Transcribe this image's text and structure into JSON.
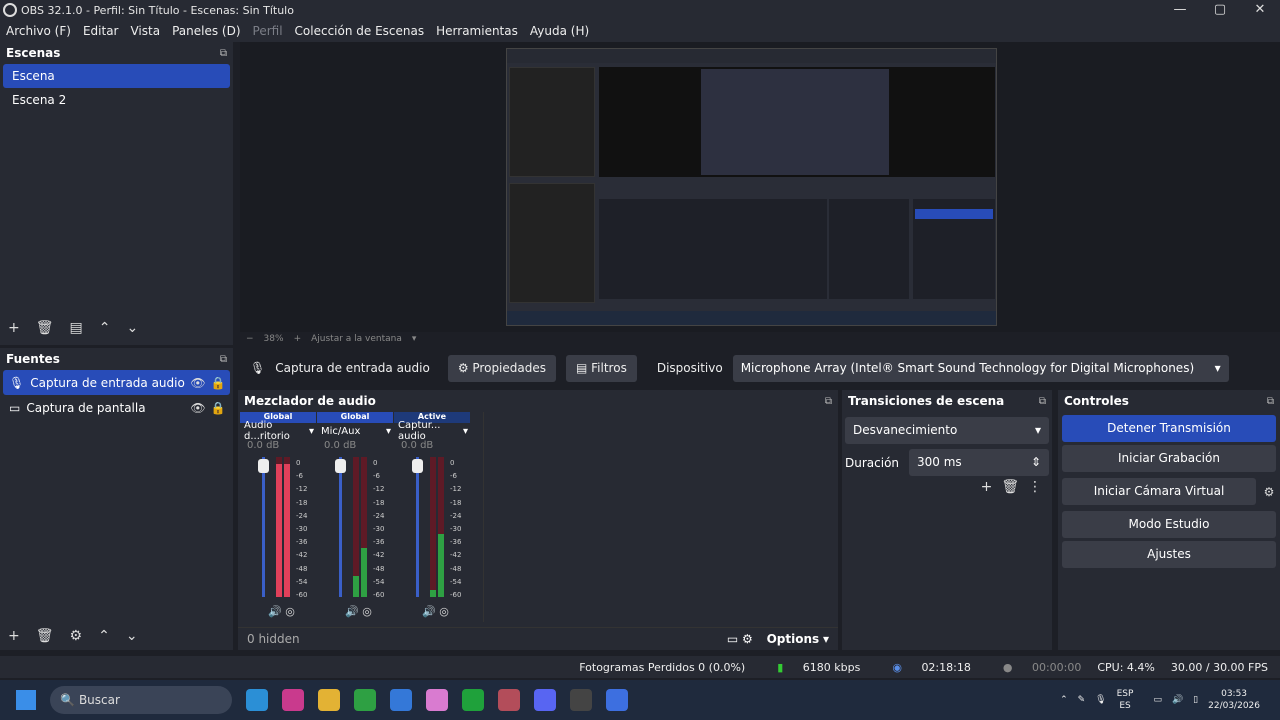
{
  "window": {
    "title": "OBS 32.1.0 - Perfil: Sin Título - Escenas: Sin Título"
  },
  "menu": [
    "Archivo (F)",
    "Editar",
    "Vista",
    "Paneles (D)",
    "Perfil",
    "Colección de Escenas",
    "Herramientas",
    "Ayuda (H)"
  ],
  "scenes": {
    "title": "Escenas",
    "items": [
      "Escena",
      "Escena 2"
    ]
  },
  "zoom": {
    "value": "38%",
    "fit": "Ajustar a la ventana"
  },
  "sources": {
    "title": "Fuentes",
    "items": [
      "Captura de entrada audio",
      "Captura de pantalla"
    ]
  },
  "context": {
    "source": "Captura de entrada audio",
    "properties": "Propiedades",
    "filters": "Filtros",
    "device_label": "Dispositivo",
    "device_value": "Microphone Array (Intel® Smart Sound Technology for Digital Microphones)"
  },
  "mixer": {
    "title": "Mezclador de audio",
    "channels": [
      {
        "tag": "Global",
        "name": "Audio d...ritorio",
        "db": "0.0 dB"
      },
      {
        "tag": "Global",
        "name": "Mic/Aux",
        "db": "0.0 dB"
      },
      {
        "tag": "Active",
        "name": "Captur... audio",
        "db": "0.0 dB"
      }
    ],
    "scale": [
      "0",
      "-6",
      "-12",
      "-18",
      "-24",
      "-30",
      "-36",
      "-42",
      "-48",
      "-54",
      "-60"
    ],
    "hidden": "0 hidden",
    "options": "Options"
  },
  "transitions": {
    "title": "Transiciones de escena",
    "type": "Desvanecimiento",
    "duration_label": "Duración",
    "duration": "300 ms"
  },
  "controls": {
    "title": "Controles",
    "buttons": [
      "Detener Transmisión",
      "Iniciar Grabación",
      "Iniciar Cámara Virtual",
      "Modo Estudio",
      "Ajustes"
    ]
  },
  "status": {
    "dropped": "Fotogramas Perdidos 0 (0.0%)",
    "bitrate": "6180 kbps",
    "stream_time": "02:18:18",
    "rec_time": "00:00:00",
    "cpu": "CPU: 4.4%",
    "fps": "30.00 / 30.00 FPS"
  },
  "taskbar": {
    "search": "Buscar",
    "lang1": "ESP",
    "lang2": "ES",
    "time": "03:53",
    "date": "22/03/2026"
  },
  "colors": {
    "accent": "#284cb8",
    "panel": "#272a33",
    "bg": "#1d1f26"
  }
}
